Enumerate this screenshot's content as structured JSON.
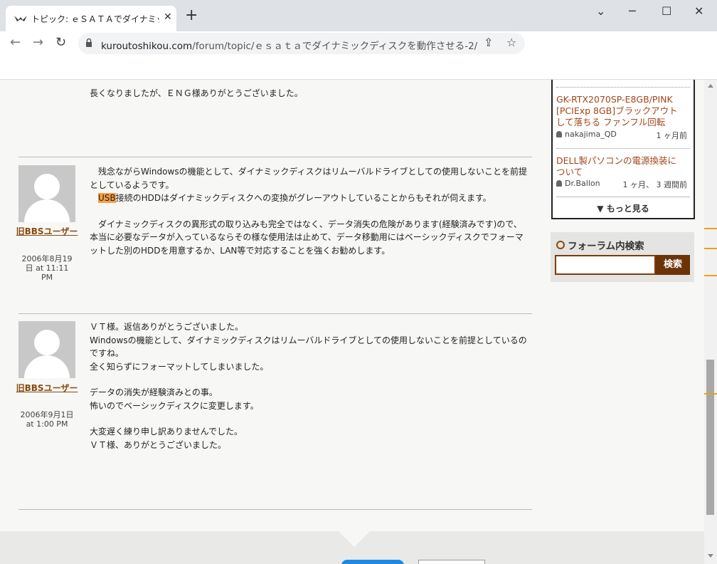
{
  "browser": {
    "tab_title": "トピック: ｅＳＡＴＡでダイナミックディ",
    "url_host": "kuroutoshikou.com",
    "url_path": "/forum/topic/ｅｓａｔａでダイナミックディスクを動作させる-2/"
  },
  "posts": {
    "prev_tail": "長くなりましたが、ＥＮＧ様ありがとうございました。",
    "p1": {
      "author": "旧BBSユーザー",
      "date_line1": "2006年8月19",
      "date_line2": "日 at 11:11",
      "date_line3": "PM",
      "l1": "　残念ながらWindowsの機能として、ダイナミックディスクはリムーバルドライブとしての使用しないことを前提",
      "l2": "としているようです。",
      "l3_hl": "USB",
      "l3_rest": "接続のHDDはダイナミックディスクへの変換がグレーアウトしていることからもそれが伺えます。",
      "l4": "　ダイナミックディスクの異形式の取り込みも完全ではなく、データ消失の危険があります(経験済みです)ので、",
      "l5": "本当に必要なデータが入っているならその様な使用法は止めて、データ移動用にはベーシックディスクでフォーマ",
      "l6": "ットした別のHDDを用意するか、LAN等で対応することを強くお勧めします。"
    },
    "p2": {
      "author": "旧BBSユーザー",
      "date_line1": "2006年9月1日",
      "date_line2": "at 1:00 PM",
      "l1": "ＶＴ様。返信ありがとうございました。",
      "l2": "Windowsの機能として、ダイナミックディスクはリムーバルドライブとしての使用しないことを前提としているの",
      "l3": "ですね。",
      "l4": "全く知らずにフォーマットしてしまいました。",
      "l5": "データの消失が経験済みとの事。",
      "l6": "怖いのでベーシックディスクに変更します。",
      "l7": "大変遅く練り申し訳ありませんでした。",
      "l8": "ＶＴ様、ありがとうございました。"
    }
  },
  "sidebar": {
    "topic1": {
      "l1": "GK-RTX2070SP-E8GB/PINK",
      "l2": "[PCIExp 8GB]ブラックアウト",
      "l3": "して落ちる ファンフル回転",
      "user": "nakajima_QD",
      "when": "1 ヶ月前"
    },
    "topic2": {
      "l1": "DELL製パソコンの電源換装に",
      "l2": "ついて",
      "user": "Dr.Ballon",
      "when": "1 ヶ月、 3 週間前"
    },
    "more": "もっと見る",
    "search_title": "フォーラム内検索",
    "search_button": "検索",
    "search_value": ""
  }
}
